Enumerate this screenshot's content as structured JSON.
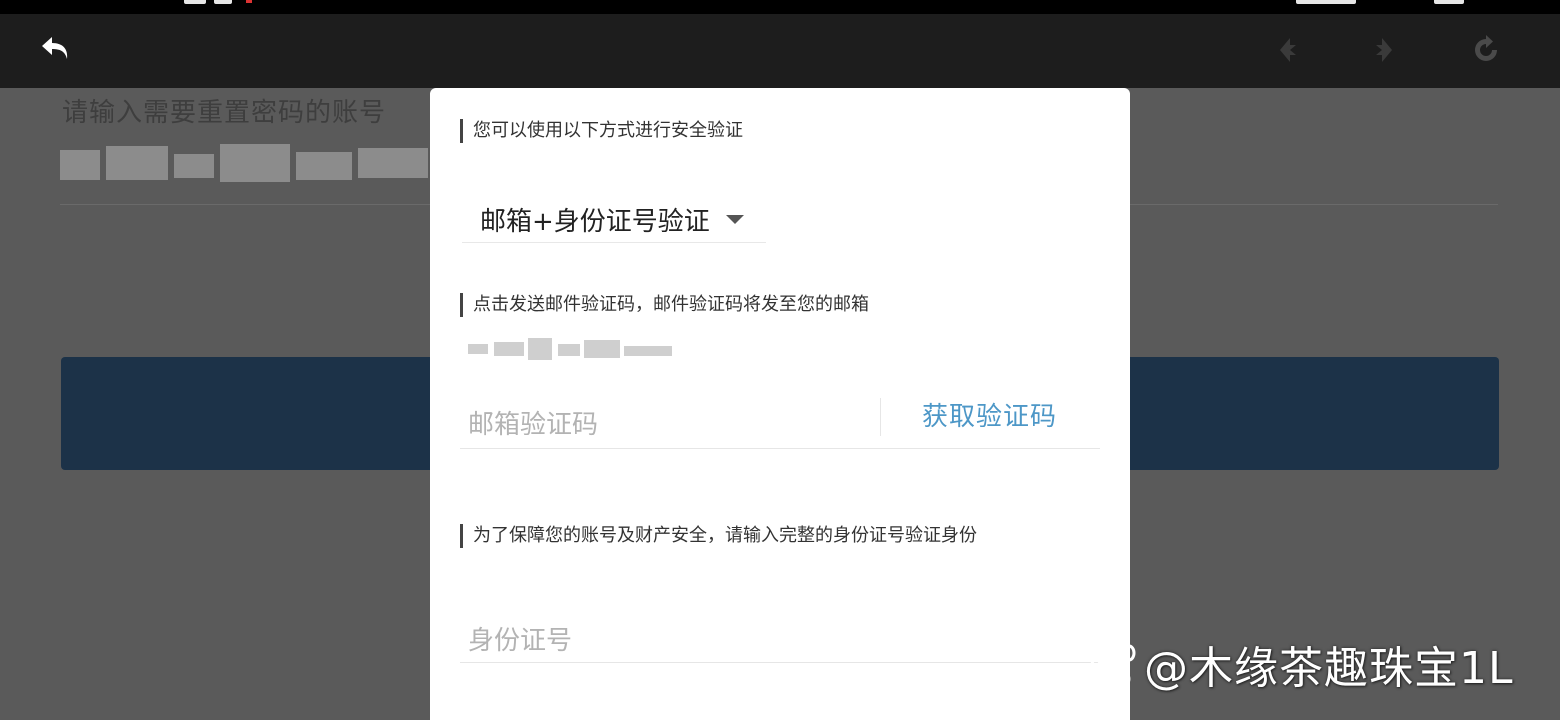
{
  "background": {
    "account_label": "请输入需要重置密码的账号"
  },
  "modal": {
    "verify_methods_label": "您可以使用以下方式进行安全验证",
    "method_select_value": "邮箱+身份证号验证",
    "email_hint": "点击发送邮件验证码，邮件验证码将发至您的邮箱",
    "email_code_placeholder": "邮箱验证码",
    "get_code_label": "获取验证码",
    "id_hint": "为了保障您的账号及财产安全，请输入完整的身份证号验证身份",
    "id_placeholder": "身份证号"
  },
  "icons": {
    "back": "back-arrow-icon",
    "prev": "prev-icon",
    "next": "next-icon",
    "refresh": "refresh-icon",
    "dropdown": "chevron-down-icon",
    "watermark_logo": "baidu-paw-icon"
  },
  "watermark": {
    "text": "@木缘茶趣珠宝1L"
  },
  "colors": {
    "toolbar_bg": "#1d1d1d",
    "link_blue": "#4d97c7",
    "overlay_button": "#1c3248"
  }
}
